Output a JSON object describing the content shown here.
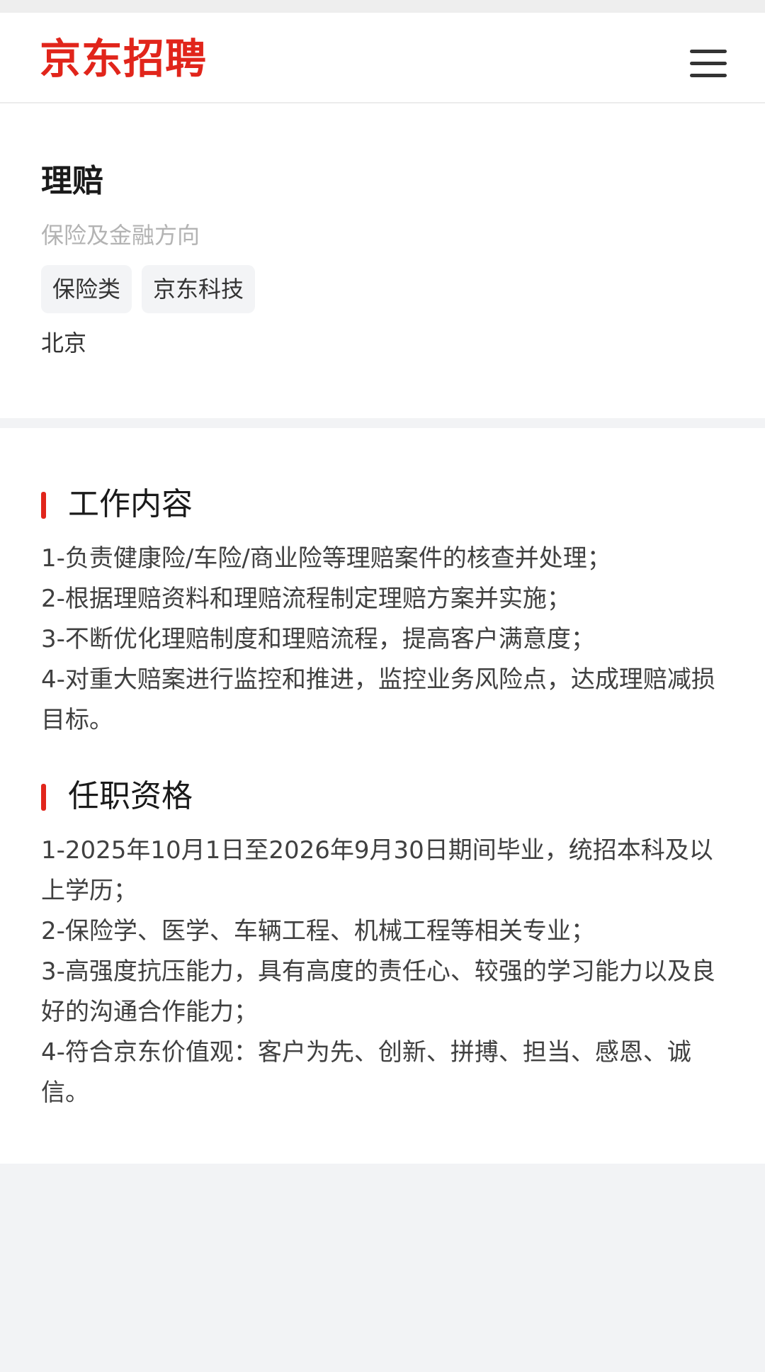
{
  "header": {
    "logo_text": "京东招聘",
    "menu_icon": "hamburger-menu-icon",
    "accent_color": "#e1251b"
  },
  "job": {
    "title": "理赔",
    "subtitle": "保险及金融方向",
    "tags": [
      "保险类",
      "京东科技"
    ],
    "location": "北京"
  },
  "sections": [
    {
      "title": "工作内容",
      "items": [
        "1-负责健康险/车险/商业险等理赔案件的核查并处理；",
        "2-根据理赔资料和理赔流程制定理赔方案并实施；",
        "3-不断优化理赔制度和理赔流程，提高客户满意度；",
        "4-对重大赔案进行监控和推进，监控业务风险点，达成理赔减损目标。"
      ]
    },
    {
      "title": "任职资格",
      "items": [
        "1-2025年10月1日至2026年9月30日期间毕业，统招本科及以上学历；",
        "2-保险学、医学、车辆工程、机械工程等相关专业；",
        "3-高强度抗压能力，具有高度的责任心、较强的学习能力以及良好的沟通合作能力；",
        "4-符合京东价值观：客户为先、创新、拼搏、担当、感恩、诚信。"
      ]
    }
  ]
}
